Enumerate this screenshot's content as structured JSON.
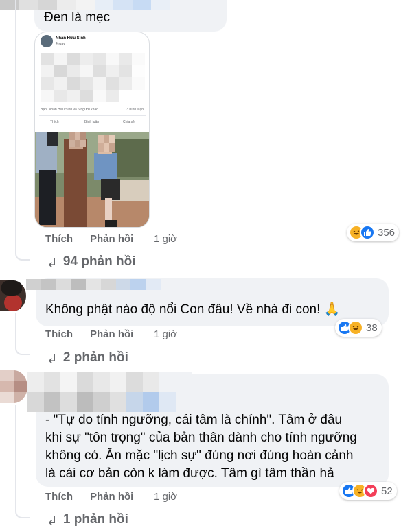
{
  "comments": [
    {
      "text_lines": [
        "Đen là mẹc"
      ],
      "shared_post": {
        "author": "Nhan Hữu Sinh",
        "time": "4ngày",
        "stats_left": "Bạn, Nhan Hữu Sinh và 6 người khác",
        "stats_right": "3 bình luận",
        "buttons": [
          "Thích",
          "Bình luận",
          "Chia sẻ"
        ]
      },
      "actions": {
        "like": "Thích",
        "reply": "Phản hồi",
        "time": "1 giờ"
      },
      "reactions": {
        "count": "356",
        "types": [
          "haha-icon",
          "like-icon"
        ]
      },
      "replies": "94 phản hồi"
    },
    {
      "text_lines": [
        "Không phật nào độ nổi Con đâu! Về nhà đi con! 🙏"
      ],
      "actions": {
        "like": "Thích",
        "reply": "Phản hồi",
        "time": "1 giờ"
      },
      "reactions": {
        "count": "38",
        "types": [
          "like-icon",
          "haha-icon"
        ]
      },
      "replies": "2 phản hồi"
    },
    {
      "text_lines": [
        "- \"Tự do tính ngưỡng, cái tâm là chính\". Tâm ở đâu",
        "khi sự \"tôn trọng\" của bản thân dành cho tính ngưỡng",
        "không có. Ăn mặc \"lịch sự\" đúng nơi đúng hoàn cảnh",
        "là cái cơ bản còn k làm được. Tâm gì tâm thần hả"
      ],
      "actions": {
        "like": "Thích",
        "reply": "Phản hồi",
        "time": "1 giờ"
      },
      "reactions": {
        "count": "52",
        "types": [
          "like-icon",
          "haha-icon",
          "love-icon"
        ]
      },
      "replies": "1 phản hồi"
    }
  ],
  "colors": {
    "bubble": "#f0f2f5",
    "secondary_text": "#65676b",
    "like_blue": "#1877f2",
    "haha_yellow": "#f7b125",
    "love_red": "#f33e58"
  }
}
